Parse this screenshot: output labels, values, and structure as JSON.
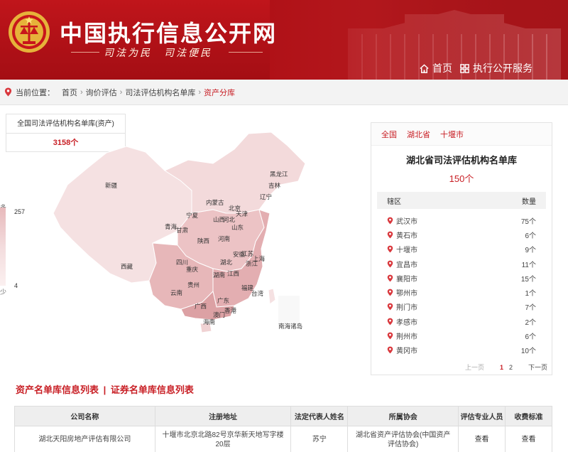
{
  "header": {
    "title": "中国执行信息公开网",
    "slogan": "司法为民　司法便民",
    "nav": [
      {
        "label": "首页",
        "icon": "home-icon"
      },
      {
        "label": "执行公开服务",
        "icon": "grid-icon"
      }
    ]
  },
  "breadcrumb": {
    "prefix": "当前位置：",
    "items": [
      "首页",
      "询价评估",
      "司法评估机构名单库"
    ],
    "active": "资产分库"
  },
  "stat": {
    "title": "全国司法评估机构名单库(资产)",
    "count": "3158个"
  },
  "map": {
    "legend_top": "多",
    "legend_bottom": "少",
    "legend_max": "257",
    "legend_min": "4",
    "regions": [
      "新疆",
      "西藏",
      "青海",
      "甘肃",
      "宁夏",
      "内蒙古",
      "黑龙江",
      "吉林",
      "辽宁",
      "北京",
      "天津",
      "河北",
      "山西",
      "山东",
      "陕西",
      "河南",
      "四川",
      "重庆",
      "湖北",
      "安徽",
      "江苏",
      "上海",
      "浙江",
      "江西",
      "湖南",
      "贵州",
      "云南",
      "福建",
      "台湾",
      "广西",
      "广东",
      "澳门",
      "香港",
      "海南",
      "南海诸岛"
    ]
  },
  "panel": {
    "tabs": [
      "全国",
      "湖北省",
      "十堰市"
    ],
    "title": "湖北省司法评估机构名单库",
    "count": "150个",
    "col_region": "辖区",
    "col_count": "数量",
    "rows": [
      {
        "name": "武汉市",
        "count": "75个"
      },
      {
        "name": "黄石市",
        "count": "6个"
      },
      {
        "name": "十堰市",
        "count": "9个"
      },
      {
        "name": "宜昌市",
        "count": "11个"
      },
      {
        "name": "襄阳市",
        "count": "15个"
      },
      {
        "name": "鄂州市",
        "count": "1个"
      },
      {
        "name": "荆门市",
        "count": "7个"
      },
      {
        "name": "孝感市",
        "count": "2个"
      },
      {
        "name": "荆州市",
        "count": "6个"
      },
      {
        "name": "黄冈市",
        "count": "10个"
      }
    ],
    "pager": {
      "prev": "上一页",
      "pages": [
        "1",
        "2"
      ],
      "next": "下一页"
    }
  },
  "section": {
    "asset_list": "资产名单库信息列表",
    "divider": "|",
    "securities_list": "证券名单库信息列表"
  },
  "table": {
    "headers": [
      "公司名称",
      "注册地址",
      "法定代表人姓名",
      "所属协会",
      "评估专业人员",
      "收费标准"
    ],
    "rows": [
      [
        "湖北天阳房地产评估有限公司",
        "十堰市北京北路82号京华新天地写字楼20层",
        "苏宁",
        "湖北省资产评估协会(中国资产评估协会)",
        "查看",
        "查看"
      ]
    ]
  },
  "colors": {
    "brand_red": "#c81e24",
    "header_red": "#b01117"
  }
}
